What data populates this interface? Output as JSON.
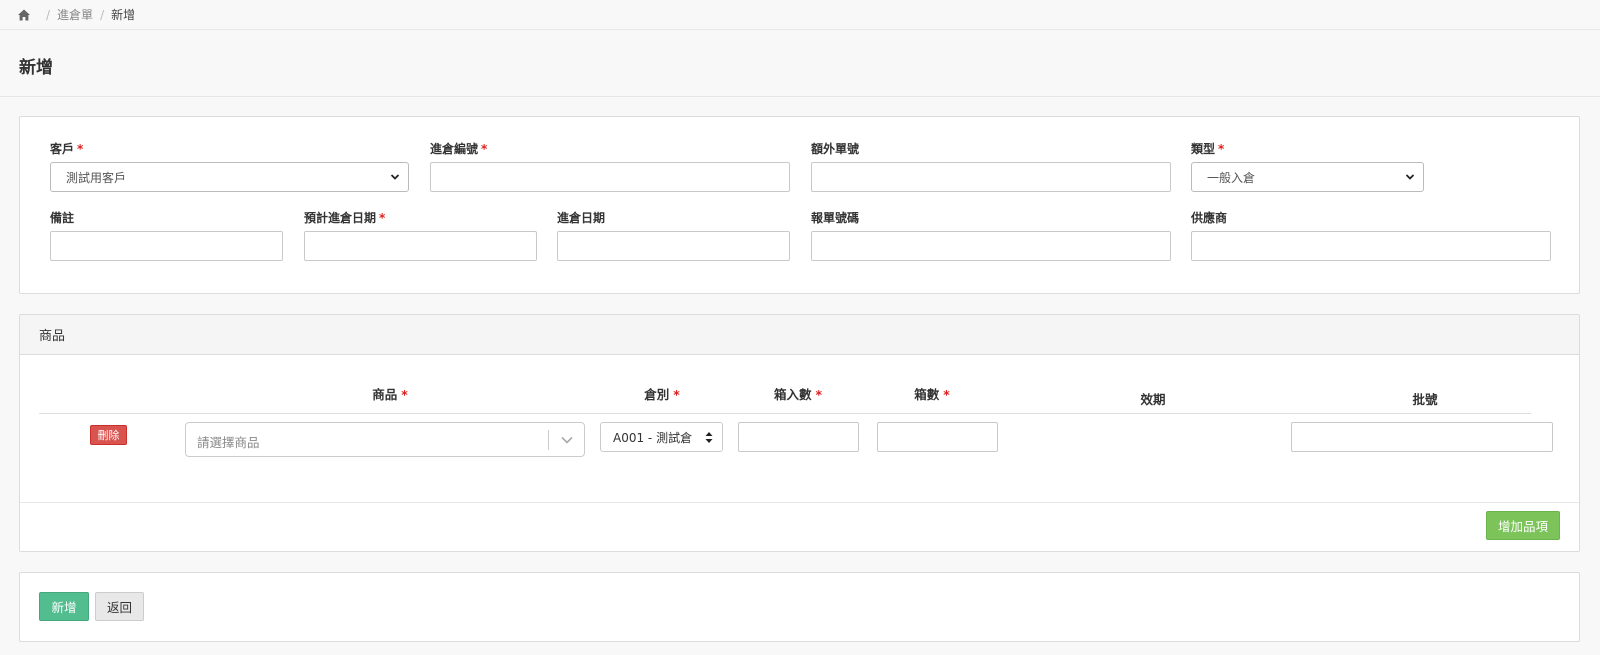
{
  "breadcrumb": {
    "home_icon": "home-icon",
    "separator": "/",
    "items": [
      "進倉單",
      "新增"
    ]
  },
  "page": {
    "title": "新增"
  },
  "form": {
    "customer": {
      "label": "客戶",
      "required": "*",
      "value": "測試用客戶"
    },
    "inbound_no": {
      "label": "進倉編號",
      "required": "*",
      "value": ""
    },
    "extra_no": {
      "label": "額外單號",
      "value": ""
    },
    "type": {
      "label": "類型",
      "required": "*",
      "value": "一般入倉"
    },
    "note": {
      "label": "備註",
      "value": ""
    },
    "expected_date": {
      "label": "預計進倉日期",
      "required": "*",
      "value": ""
    },
    "inbound_date": {
      "label": "進倉日期",
      "value": ""
    },
    "declaration_no": {
      "label": "報單號碼",
      "value": ""
    },
    "supplier": {
      "label": "供應商",
      "value": ""
    }
  },
  "products": {
    "heading": "商品",
    "columns": [
      {
        "label": "商品",
        "required": "*"
      },
      {
        "label": "倉別",
        "required": "*"
      },
      {
        "label": "箱入數",
        "required": "*"
      },
      {
        "label": "箱數",
        "required": "*"
      },
      {
        "label": "效期"
      },
      {
        "label": "批號"
      }
    ],
    "row": {
      "delete_label": "刪除",
      "product_placeholder": "請選擇商品",
      "warehouse_value": "A001 - 測試倉",
      "per_box": "",
      "box_count": "",
      "batch_no": ""
    },
    "add_item_label": "增加品項"
  },
  "actions": {
    "submit_label": "新增",
    "back_label": "返回"
  },
  "colors": {
    "required": "#e02020",
    "delete": "#d9534f",
    "add_item": "#7cc45a",
    "submit": "#52bd8f"
  }
}
